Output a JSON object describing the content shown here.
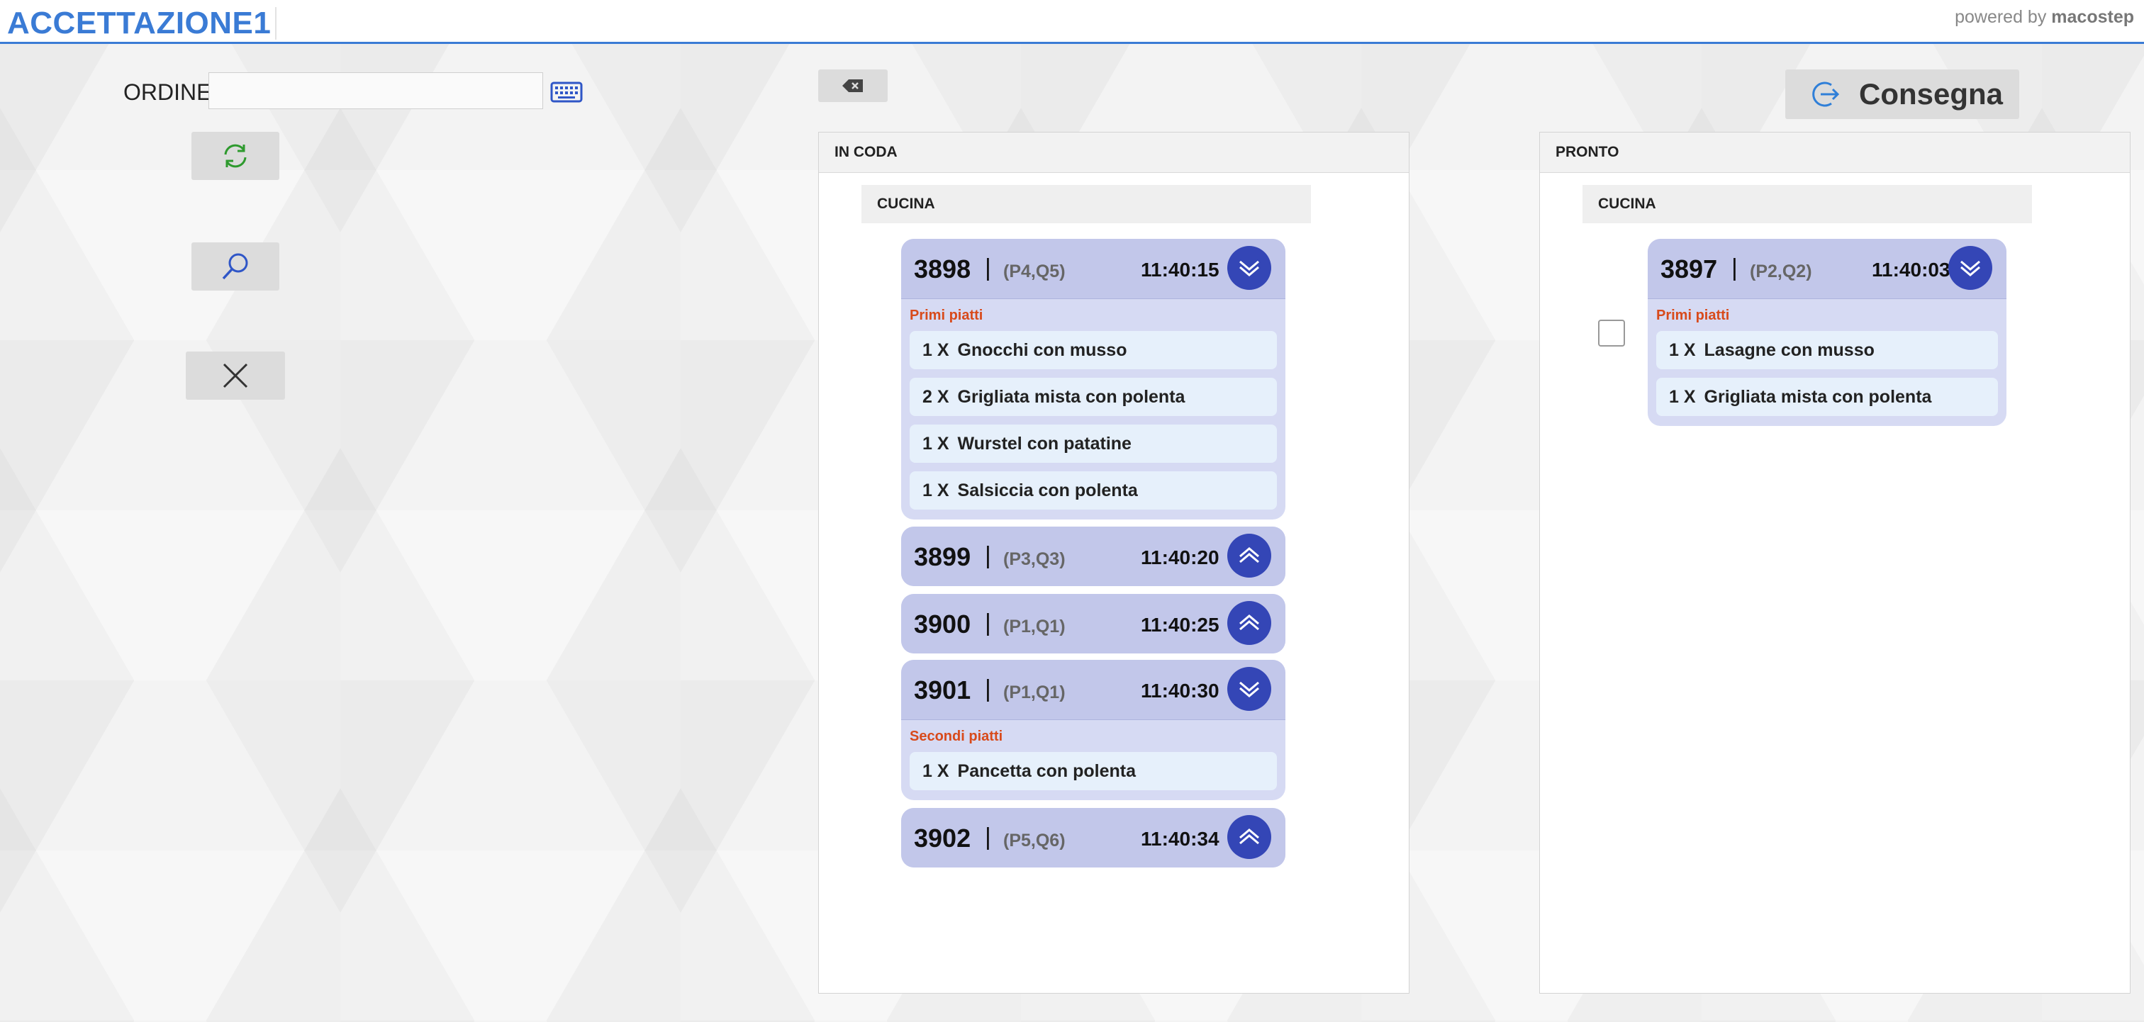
{
  "header": {
    "app_title": "ACCETTAZIONE1",
    "powered_prefix": "powered by",
    "powered_brand": "macostep"
  },
  "search": {
    "label": "ORDINE",
    "value": "",
    "placeholder": ""
  },
  "actions": {
    "consegna_label": "Consegna"
  },
  "queue_panel": {
    "title": "IN CODA",
    "section": "CUCINA",
    "orders": [
      {
        "number": "3898",
        "sep": "|",
        "tables": "(P4,Q5)",
        "time": "11:40:15",
        "expanded": true,
        "category": "Primi piatti",
        "items": [
          {
            "qty": "1 X",
            "name": "Gnocchi con musso"
          },
          {
            "qty": "2 X",
            "name": "Grigliata mista con polenta"
          },
          {
            "qty": "1 X",
            "name": "Wurstel con patatine"
          },
          {
            "qty": "1 X",
            "name": "Salsiccia con polenta"
          }
        ]
      },
      {
        "number": "3899",
        "sep": "|",
        "tables": "(P3,Q3)",
        "time": "11:40:20",
        "expanded": false
      },
      {
        "number": "3900",
        "sep": "|",
        "tables": "(P1,Q1)",
        "time": "11:40:25",
        "expanded": false
      },
      {
        "number": "3901",
        "sep": "|",
        "tables": "(P1,Q1)",
        "time": "11:40:30",
        "expanded": true,
        "category": "Secondi piatti",
        "items": [
          {
            "qty": "1 X",
            "name": "Pancetta con polenta"
          }
        ]
      },
      {
        "number": "3902",
        "sep": "|",
        "tables": "(P5,Q6)",
        "time": "11:40:34",
        "expanded": false
      }
    ]
  },
  "ready_panel": {
    "title": "PRONTO",
    "section": "CUCINA",
    "orders": [
      {
        "number": "3897",
        "sep": "|",
        "tables": "(P2,Q2)",
        "time": "11:40:03",
        "expanded": true,
        "checked": false,
        "category": "Primi piatti",
        "items": [
          {
            "qty": "1 X",
            "name": "Lasagne con musso"
          },
          {
            "qty": "1 X",
            "name": "Grigliata mista con polenta"
          }
        ]
      }
    ]
  },
  "colors": {
    "accent": "#3a7bd5",
    "card": "#d6daf3",
    "card_head": "#c2c7ea",
    "toggle": "#3446b6",
    "category": "#d84a1b"
  },
  "icons": {
    "keyboard": "keyboard-icon",
    "refresh": "refresh-icon",
    "search": "search-icon",
    "close": "close-icon",
    "backspace": "backspace-icon",
    "logout": "logout-icon",
    "expand": "chevron-down-icon",
    "collapse": "chevron-up-icon"
  }
}
